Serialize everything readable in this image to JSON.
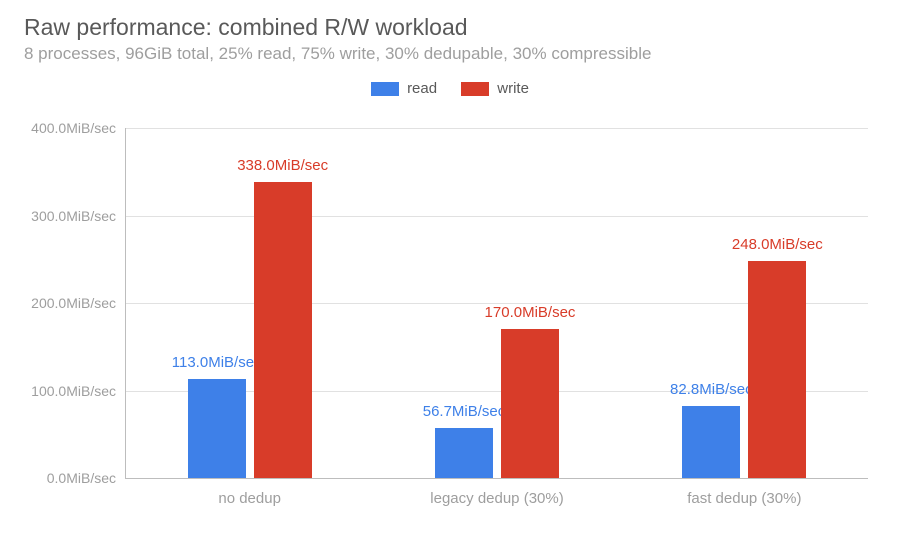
{
  "title": "Raw performance: combined R/W workload",
  "subtitle": "8 processes, 96GiB total, 25% read, 75% write, 30% dedupable, 30% compressible",
  "legend": {
    "read": "read",
    "write": "write"
  },
  "colors": {
    "read": "#3e80e8",
    "write": "#d83c29"
  },
  "chart_data": {
    "type": "bar",
    "categories": [
      "no dedup",
      "legacy dedup (30%)",
      "fast dedup (30%)"
    ],
    "series": [
      {
        "name": "read",
        "values": [
          113.0,
          56.7,
          82.8
        ]
      },
      {
        "name": "write",
        "values": [
          338.0,
          170.0,
          248.0
        ]
      }
    ],
    "value_unit": "MiB/sec",
    "ylim": [
      0,
      400
    ],
    "ytick_step": 100,
    "ylabel": "",
    "xlabel": "",
    "legend_position": "top",
    "grid": true
  }
}
